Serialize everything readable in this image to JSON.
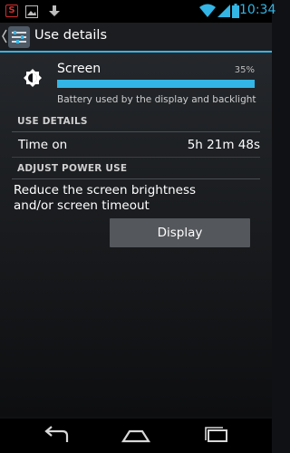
{
  "status_bar": {
    "time": "10:34"
  },
  "action_bar": {
    "title": "Use details"
  },
  "screen_usage": {
    "title": "Screen",
    "percent_label": "35%",
    "percent": 35,
    "description": "Battery used by the display and backlight"
  },
  "use_details": {
    "header": "USE DETAILS",
    "rows": [
      {
        "label": "Time on",
        "value": "5h 21m 48s"
      }
    ]
  },
  "adjust_power": {
    "header": "ADJUST POWER USE",
    "description": "Reduce the screen brightness and/or screen timeout",
    "button_label": "Display"
  },
  "colors": {
    "accent": "#33b5e5",
    "notification_red": "#d32f2f"
  },
  "icons": {
    "status_left": [
      "notification-s-icon",
      "gallery-icon",
      "download-icon"
    ],
    "status_right": [
      "wifi-icon",
      "signal-icon",
      "battery-icon"
    ],
    "screen": "brightness-icon",
    "nav": [
      "back-icon",
      "home-icon",
      "recents-icon"
    ]
  }
}
